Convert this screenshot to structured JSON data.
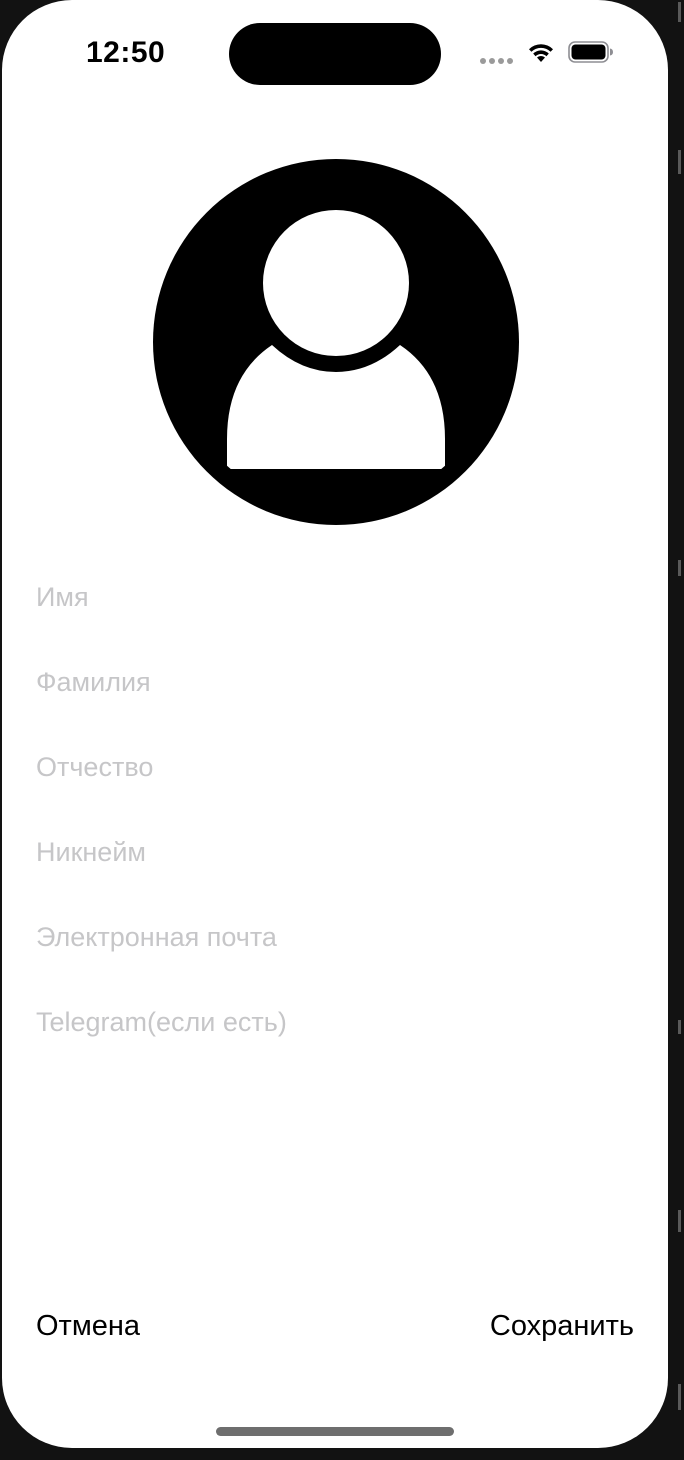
{
  "status_bar": {
    "time": "12:50",
    "icons": [
      "cellular-signal-icon",
      "wifi-icon",
      "battery-icon"
    ]
  },
  "avatar": {
    "icon": "person-circle-icon"
  },
  "form": {
    "first_name": {
      "value": "",
      "placeholder": "Имя"
    },
    "last_name": {
      "value": "",
      "placeholder": "Фамилия"
    },
    "middle_name": {
      "value": "",
      "placeholder": "Отчество"
    },
    "nickname": {
      "value": "",
      "placeholder": "Никнейм"
    },
    "email": {
      "value": "",
      "placeholder": "Электронная почта"
    },
    "telegram": {
      "value": "",
      "placeholder": "Telegram(если есть)"
    }
  },
  "actions": {
    "cancel_label": "Отмена",
    "save_label": "Сохранить"
  },
  "colors": {
    "placeholder": "#c6c6c8",
    "text": "#000000",
    "background": "#ffffff"
  }
}
